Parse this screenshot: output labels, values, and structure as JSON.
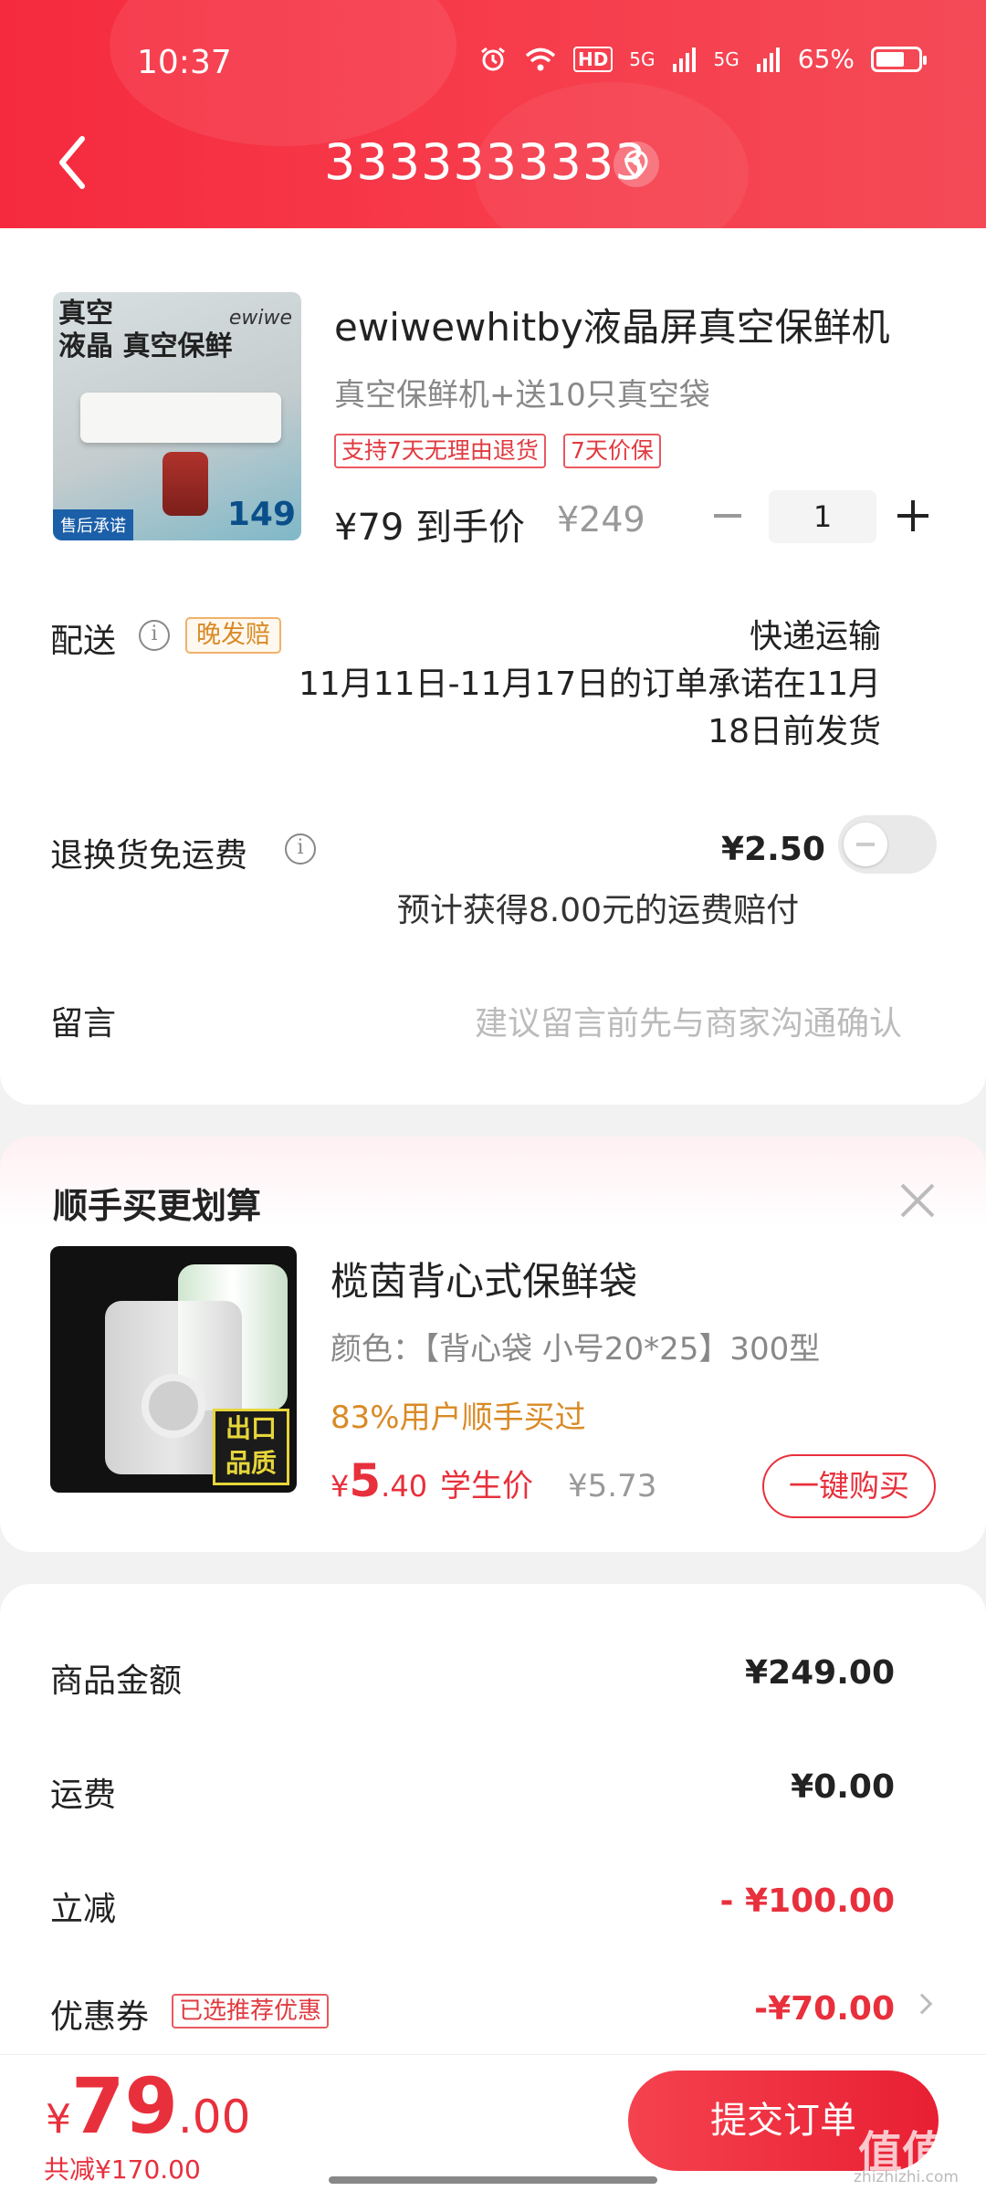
{
  "status_bar": {
    "time": "10:37",
    "hd": "HD",
    "net1": "5G",
    "net2": "5G",
    "battery": "65%"
  },
  "header": {
    "title": "3333333333"
  },
  "product": {
    "title": "ewiwewhitby液晶屏真空保鲜机",
    "variant": "真空保鲜机+送10只真空袋",
    "tags": [
      "支持7天无理由退货",
      "7天价保"
    ],
    "price_now": "¥79 到手价",
    "price_old": "¥249",
    "quantity": "1",
    "image_text": {
      "top": "真空\n液晶 真空保鲜",
      "brand": "ewiwe",
      "price": "149",
      "after_sale": "售后承诺"
    }
  },
  "delivery": {
    "label": "配送",
    "badge": "晚发赔",
    "method": "快递运输",
    "note_line1": "11月11日-11月17日的订单承诺在11月",
    "note_line2": "18日前发货"
  },
  "refund": {
    "label": "退换货免运费",
    "price": "¥2.50",
    "note": "预计获得8.00元的运费赔付",
    "enabled": false
  },
  "message": {
    "label": "留言",
    "placeholder": "建议留言前先与商家沟通确认"
  },
  "upsell": {
    "title": "顺手买更划算",
    "product_title": "榄茵背心式保鲜袋",
    "spec": "颜色：【背心袋 小号20*25】300型",
    "buyers": "83%用户顺手买过",
    "price_currency": "¥",
    "price_int": "5",
    "price_dec": ".40",
    "price_label": "学生价",
    "price_old": "¥5.73",
    "buy_button": "一键购买",
    "image_badge": "出口品质"
  },
  "summary": {
    "rows": [
      {
        "label": "商品金额",
        "value": "¥249.00"
      },
      {
        "label": "运费",
        "value": "¥0.00"
      },
      {
        "label": "立减",
        "value": "- ¥100.00"
      },
      {
        "label": "优惠券",
        "value": "-¥70.00"
      }
    ],
    "coupon_badge": "已选推荐优惠"
  },
  "bottom": {
    "currency": "¥",
    "total_int": "79",
    "total_dec": ".00",
    "saved": "共减¥170.00",
    "submit": "提交订单",
    "watermark": "值值值",
    "watermark_url": "zhizhizhi.com"
  },
  "colors": {
    "brand_red": "#f52a3e",
    "price_red": "#e8303c",
    "orange": "#d98a25"
  }
}
